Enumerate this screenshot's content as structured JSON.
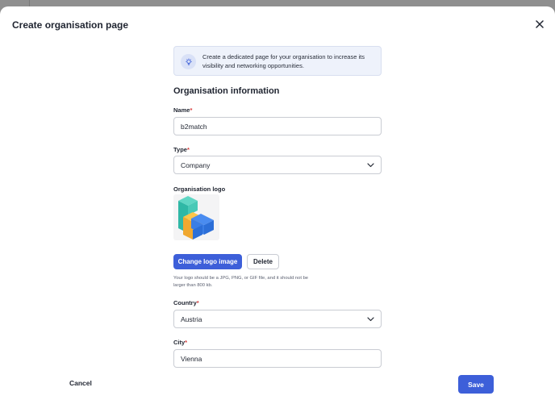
{
  "modal": {
    "title": "Create organisation page",
    "close_icon": "close-icon"
  },
  "info": {
    "icon": "lightbulb-icon",
    "text": "Create a dedicated page for your organisation to increase its visibility and networking opportunities."
  },
  "section_title": "Organisation information",
  "fields": {
    "name": {
      "label": "Name",
      "required_mark": "*",
      "value": "b2match"
    },
    "type": {
      "label": "Type",
      "required_mark": "*",
      "value": "Company"
    },
    "logo": {
      "label": "Organisation logo"
    },
    "country": {
      "label": "Country",
      "required_mark": "*",
      "value": "Austria"
    },
    "city": {
      "label": "City",
      "required_mark": "*",
      "value": "Vienna"
    }
  },
  "logo_actions": {
    "change_label": "Change logo image",
    "delete_label": "Delete",
    "hint": "Your logo should be a JPG, PNG, or GIF file, and it should not be larger than 800 kb."
  },
  "footer": {
    "cancel_label": "Cancel",
    "save_label": "Save"
  },
  "colors": {
    "primary": "#3d5fd9",
    "required": "#d63a3a",
    "info_bg": "#eef2fb"
  }
}
